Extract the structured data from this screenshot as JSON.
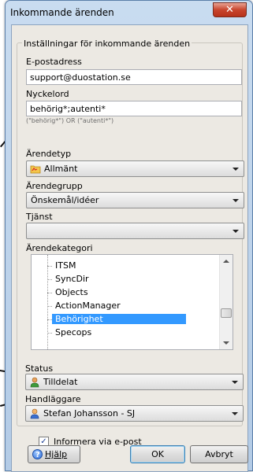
{
  "window": {
    "title": "Inkommande ärenden",
    "close_glyph": "✕"
  },
  "group": {
    "title": "Inställningar för inkommande ärenden"
  },
  "email": {
    "label": "E-postadress",
    "value": "support@duostation.se"
  },
  "keyword": {
    "label": "Nyckelord",
    "value": "behörig*;autenti*",
    "hint": "(\"behörig*\") OR (\"autenti*\")"
  },
  "type": {
    "label": "Ärendetyp",
    "value": "Allmänt",
    "icon": "folder-icon"
  },
  "group_select": {
    "label": "Ärendegrupp",
    "value": "Önskemål/idéer"
  },
  "service": {
    "label": "Tjänst",
    "value": ""
  },
  "category": {
    "label": "Ärendekategori",
    "items": [
      "ITSM",
      "SyncDir",
      "Objects",
      "ActionManager",
      "Behörighet",
      "Specops"
    ],
    "selected": "Behörighet"
  },
  "status": {
    "label": "Status",
    "value": "Tilldelat",
    "icon": "person-status-icon"
  },
  "handler": {
    "label": "Handläggare",
    "value": "Stefan Johansson - SJ",
    "icon": "user-icon"
  },
  "notify": {
    "label": "Informera via e-post",
    "checked": true
  },
  "buttons": {
    "help": "Hjälp",
    "ok": "OK",
    "cancel": "Avbryt"
  },
  "colors": {
    "selection": "#3399ff",
    "close_button": "#c8452d",
    "window_frame": "#b3cbe6"
  }
}
